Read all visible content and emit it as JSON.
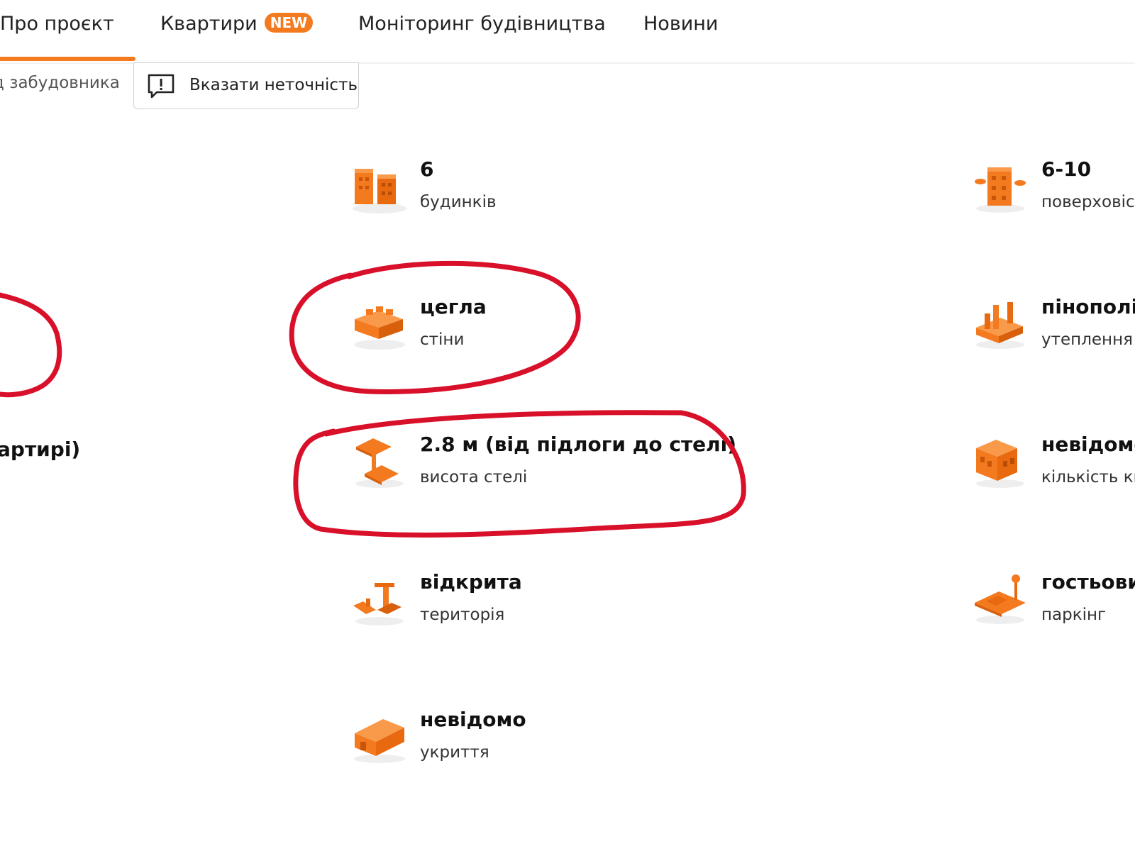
{
  "nav": {
    "tabs": [
      {
        "label": "Про проєкт"
      },
      {
        "label": "Квартири",
        "badge": "NEW"
      },
      {
        "label": "Моніторинг будівництва"
      },
      {
        "label": "Новини"
      }
    ]
  },
  "subbar": {
    "developer_link": "д забудовника",
    "report_label": "Вказати неточність"
  },
  "left_partial": {
    "text": "артирі)"
  },
  "features_mid": [
    {
      "value": "6",
      "label": "будинків",
      "icon": "buildings-icon"
    },
    {
      "value": "цегла",
      "label": "стіни",
      "icon": "brick-icon"
    },
    {
      "value": "2.8 м (від підлоги до стелі)",
      "label": "висота стелі",
      "icon": "ceiling-height-icon"
    },
    {
      "value": "відкрита",
      "label": "територія",
      "icon": "territory-icon"
    },
    {
      "value": "невідомо",
      "label": "укриття",
      "icon": "shelter-icon"
    }
  ],
  "features_right": [
    {
      "value": "6-10",
      "label": "поверховіст",
      "icon": "floors-icon"
    },
    {
      "value": "пінополіс",
      "label": "утеплення",
      "icon": "insulation-icon"
    },
    {
      "value": "невідомо",
      "label": "кількість кв",
      "icon": "apartments-icon"
    },
    {
      "value": "гостьови",
      "label": "паркінг",
      "icon": "parking-icon"
    }
  ],
  "colors": {
    "accent": "#f47a20",
    "highlight": "#d8102a"
  }
}
